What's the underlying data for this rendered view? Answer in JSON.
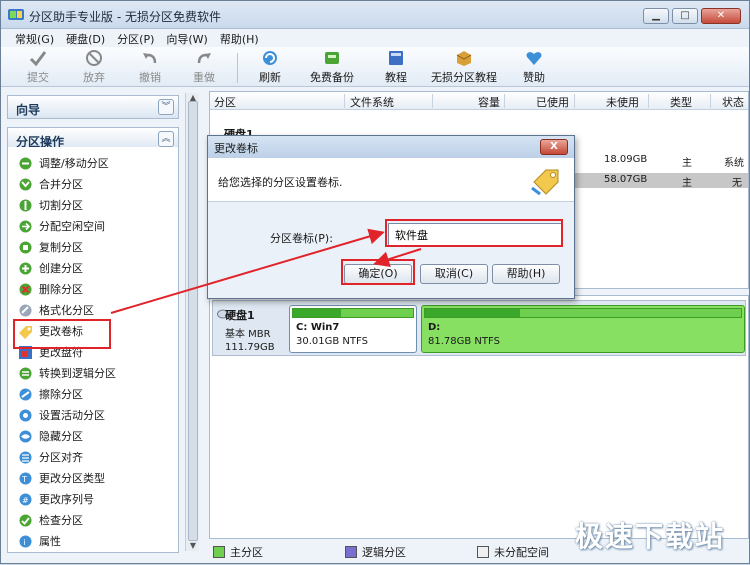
{
  "window": {
    "title": "分区助手专业版 - 无损分区免费软件",
    "controls": [
      "minimize",
      "maximize",
      "close"
    ]
  },
  "menu": [
    "常规(G)",
    "硬盘(D)",
    "分区(P)",
    "向导(W)",
    "帮助(H)"
  ],
  "toolbar": {
    "submit": "提交",
    "discard": "放弃",
    "undo": "撤销",
    "redo": "重做",
    "refresh": "刷新",
    "backup": "免费备份",
    "tutorial": "教程",
    "lossless_tutorial": "无损分区教程",
    "donate": "赞助"
  },
  "left": {
    "wizard_title": "向导",
    "ops_title": "分区操作",
    "ops": [
      "调整/移动分区",
      "合并分区",
      "切割分区",
      "分配空闲空间",
      "复制分区",
      "创建分区",
      "删除分区",
      "格式化分区",
      "更改卷标",
      "更改盘符",
      "转换到逻辑分区",
      "擦除分区",
      "设置活动分区",
      "隐藏分区",
      "分区对齐",
      "更改分区类型",
      "更改序列号",
      "检查分区",
      "属性"
    ]
  },
  "table": {
    "headers": [
      "分区",
      "文件系统",
      "容量",
      "已使用",
      "未使用",
      "类型",
      "状态"
    ],
    "disk_label": "硬盘1",
    "rows": [
      {
        "unused": "18.09GB",
        "type": "主",
        "status": "系统"
      },
      {
        "unused": "58.07GB",
        "type": "主",
        "status": "无"
      }
    ]
  },
  "diskmap": {
    "disk_name": "硬盘1",
    "disk_type": "基本 MBR",
    "disk_size": "111.79GB",
    "partitions": [
      {
        "name": "C: Win7",
        "size": "30.01GB NTFS",
        "used_fraction": 0.4
      },
      {
        "name": "D:",
        "size": "81.78GB NTFS",
        "used_fraction": 0.3
      }
    ]
  },
  "legend": [
    "主分区",
    "逻辑分区",
    "未分配空间"
  ],
  "dialog": {
    "title": "更改卷标",
    "close": "X",
    "prompt": "给您选择的分区设置卷标.",
    "field_label": "分区卷标(P):",
    "field_value": "软件盘",
    "ok": "确定(O)",
    "cancel": "取消(C)",
    "help": "帮助(H)"
  },
  "watermark": "极速下载站",
  "colors": {
    "annotation_red": "#e0242a",
    "primary_partition": "#6fd04f",
    "logical_partition": "#7a6fd0",
    "unallocated": "#f0f0f0"
  }
}
